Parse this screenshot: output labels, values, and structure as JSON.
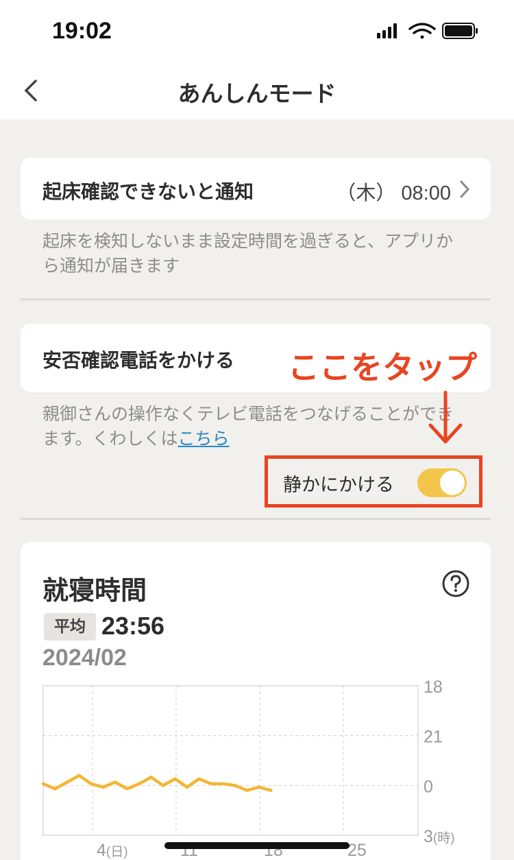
{
  "status_bar": {
    "time": "19:02"
  },
  "nav": {
    "title": "あんしんモード",
    "back_icon": "chevron-left-icon"
  },
  "wake_notice": {
    "title": "起床確認できないと通知",
    "value": "（木） 08:00",
    "description": "起床を検知しないまま設定時間を過ぎると、アプリから通知が届きます"
  },
  "safety_call": {
    "title": "安否確認電話をかける",
    "description_prefix": "親御さんの操作なくテレビ電話をつなげることができます。くわしくは",
    "link_text": "こちら",
    "quiet_label": "静かにかける",
    "quiet_on": true
  },
  "annotation": {
    "text": "ここをタップ",
    "color": "#e84520"
  },
  "sleep": {
    "title": "就寝時間",
    "avg_badge": "平均",
    "avg_value": "23:56",
    "month": "2024/02"
  },
  "chart_data": {
    "type": "line",
    "x_ticks": [
      "4(日)",
      "11",
      "18",
      "25"
    ],
    "y_ticks": [
      "18",
      "21",
      "0",
      "3(時)"
    ],
    "ylim": [
      18,
      27
    ],
    "color": "#f2b632",
    "series": [
      {
        "values": [
          23.9,
          24.2,
          23.8,
          23.4,
          23.9,
          24.1,
          23.8,
          24.2,
          23.9,
          23.5,
          24.0,
          23.6,
          24.1,
          23.6,
          23.9,
          23.9,
          24.0,
          24.3,
          24.1,
          24.3
        ]
      }
    ]
  }
}
